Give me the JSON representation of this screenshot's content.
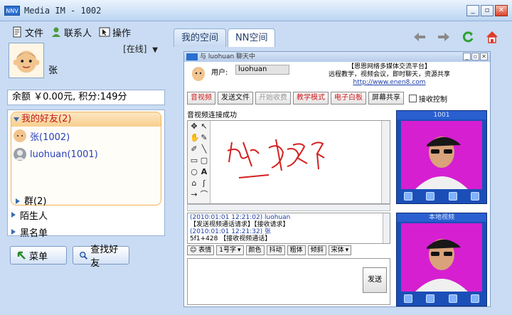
{
  "window": {
    "logo": "NNV",
    "title": "Media IM - 1002",
    "min": "_",
    "max": "▫",
    "close": "✕"
  },
  "menu": {
    "file": "文件",
    "contacts": "联系人",
    "operate": "操作"
  },
  "profile": {
    "name": "张",
    "status": "[在线]",
    "balance": "余额 ￥0.00元, 积分:149分"
  },
  "friends": {
    "group_title": "我的好友(2)",
    "items": [
      {
        "label": "张(1002)"
      },
      {
        "label": "luohuan(1001)"
      }
    ],
    "qun": "群(2)",
    "strangers": "陌生人",
    "blacklist": "黑名单"
  },
  "buttons": {
    "menu": "菜单",
    "find_friend": "查找好友"
  },
  "tabs": [
    {
      "label": "我的空间"
    },
    {
      "label": "NN空间"
    }
  ],
  "chat": {
    "title": "与 luohuan 聊天中",
    "user_label": "用户:",
    "user_value": "luohuan",
    "banner_line1": "【恩恩网络多媒体交流平台】",
    "banner_line2": "远程教学，视频会议，即时聊天，资源共享",
    "banner_url": "http://www.enen8.com",
    "toolbar": {
      "video": "音视频",
      "send_file": "发送文件",
      "start_charge": "开始收费",
      "teach_mode": "教学模式",
      "whiteboard": "电子白板",
      "screen_share": "屏幕共享",
      "receive_control": "接收控制"
    },
    "video_status": "音视频连接成功",
    "log": [
      {
        "text": "(2010:01:01 12:21:02)  luohuan",
        "kind": "blue"
      },
      {
        "text": "【发送视频通话请求】【接收请求】",
        "kind": "plain"
      },
      {
        "text": "(2010:01:01 12:21:32)  张",
        "kind": "blue"
      },
      {
        "text": "5f1+428  【接收视频通话】",
        "kind": "plain"
      }
    ],
    "format": {
      "emotion": "表情",
      "size": "1号字",
      "color": "颜色",
      "shake": "抖动",
      "bold": "粗体",
      "italic": "倾斜",
      "font": "宋体"
    },
    "send": "发送",
    "video_headers": [
      "1001",
      "本地视频"
    ]
  }
}
